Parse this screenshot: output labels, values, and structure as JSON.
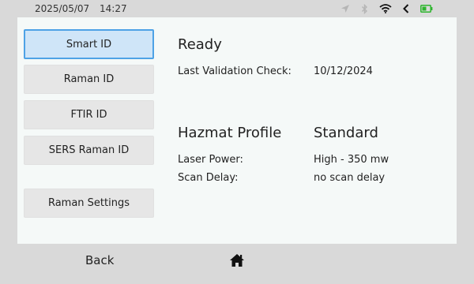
{
  "status_bar": {
    "date": "2025/05/07",
    "time": "14:27",
    "icons": [
      "location-arrow-icon",
      "bluetooth-icon",
      "wifi-icon",
      "back-chevron-icon",
      "battery-icon"
    ],
    "battery_color": "#2db52d"
  },
  "sidebar": {
    "items": [
      {
        "label": "Smart ID",
        "active": true
      },
      {
        "label": "Raman ID",
        "active": false
      },
      {
        "label": "FTIR ID",
        "active": false
      },
      {
        "label": "SERS Raman ID",
        "active": false
      },
      {
        "label": "Raman Settings",
        "active": false
      }
    ],
    "active_color": "#4ea2e6"
  },
  "main": {
    "status_title": "Ready",
    "validation_label": "Last Validation Check:",
    "validation_value": "10/12/2024",
    "profile_label": "Hazmat Profile",
    "profile_value": "Standard",
    "laser_label": "Laser Power:",
    "laser_value": "High - 350 mw",
    "scan_label": "Scan Delay:",
    "scan_value": "no scan delay"
  },
  "bottom_nav": {
    "back_label": "Back",
    "home_icon": "home-icon"
  }
}
